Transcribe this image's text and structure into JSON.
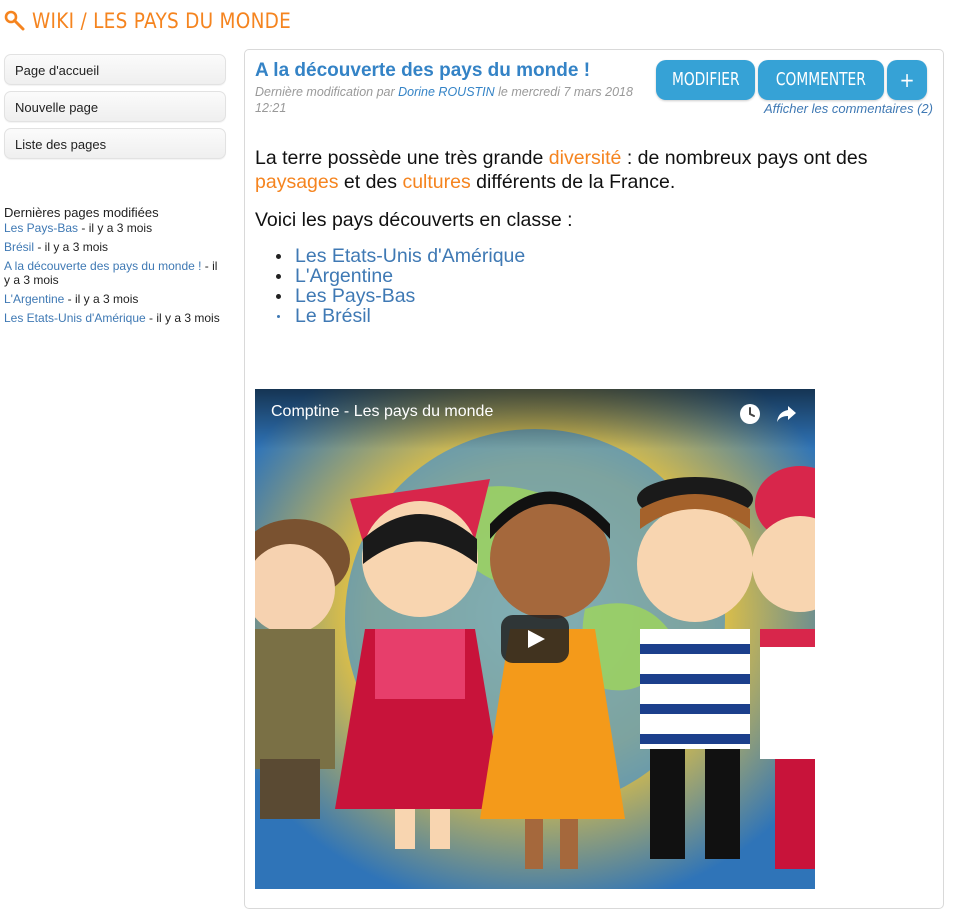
{
  "header": {
    "title": "WIKI / LES PAYS DU MONDE",
    "icon": "search-icon",
    "color": "#f5841f"
  },
  "sidebar": {
    "nav": [
      "Page d'accueil",
      "Nouvelle page",
      "Liste des pages"
    ],
    "recent_title": "Dernières pages modifiées",
    "recent": [
      {
        "link": "Les Pays-Bas",
        "age": " - il y a 3 mois"
      },
      {
        "link": "Brésil",
        "age": " - il y a 3 mois"
      },
      {
        "link": "A la découverte des pays du monde !",
        "age": " - il y a 3 mois"
      },
      {
        "link": "L'Argentine",
        "age": " - il y a 3 mois"
      },
      {
        "link": "Les Etats-Unis d'Amérique",
        "age": " - il y a 3 mois"
      }
    ]
  },
  "page": {
    "title": "A la découverte des pays du monde !",
    "meta_prefix": "Dernière modification par ",
    "author": "Dorine ROUSTIN",
    "meta_suffix": " le mercredi 7 mars 2018 12:21",
    "actions": {
      "edit": "MODIFIER",
      "comment": "COMMENTER",
      "more": "+"
    },
    "comments_link": "Afficher les commentaires (2)",
    "para1": {
      "a": "La terre possède une très grande ",
      "b": "diversité",
      "c": " : de nombreux pays ont des ",
      "d": "paysages",
      "e": " et des ",
      "f": "cultures",
      "g": " différents de la France."
    },
    "para2": "Voici les pays découverts en classe :",
    "countries": [
      "Les Etats-Unis d'Amérique",
      "L'Argentine",
      "Les Pays-Bas",
      "Le Brésil"
    ]
  },
  "video": {
    "title": "Comptine - Les pays du monde",
    "icons": [
      "clock-icon",
      "share-icon",
      "play-icon"
    ]
  },
  "colors": {
    "accent": "#f5841f",
    "link": "#3f79b4",
    "title": "#3483c6",
    "button": "#36a2d6"
  }
}
